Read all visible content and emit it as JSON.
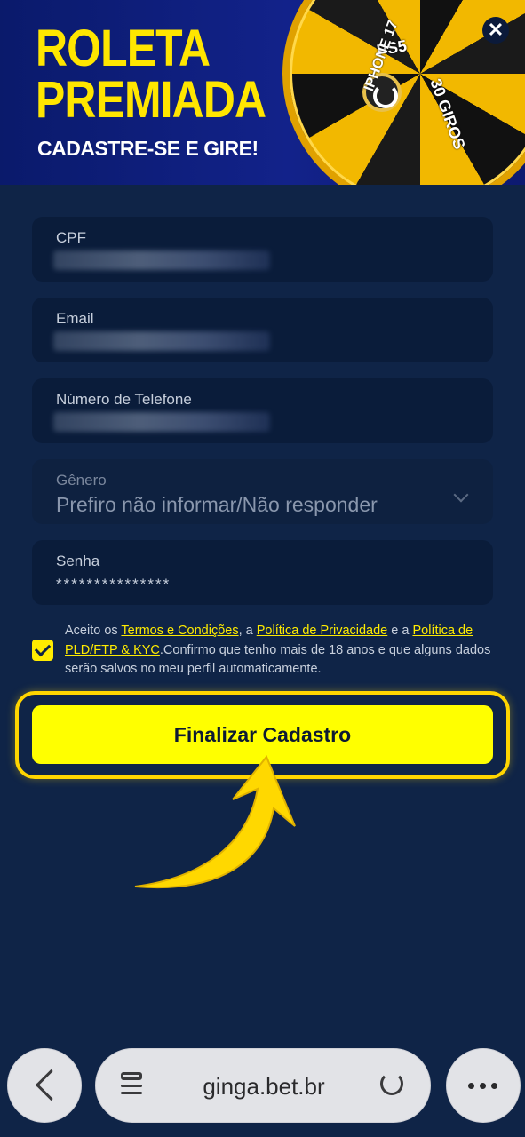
{
  "banner": {
    "title": "ROLETA PREMIADA",
    "subtitle": "CADASTRE-SE E GIRE!",
    "wheel_labels": [
      "PS5",
      "IPHONE 17",
      "30 GIROS"
    ],
    "close_label": "✕"
  },
  "form": {
    "cpf_label": "CPF",
    "email_label": "Email",
    "phone_label": "Número de Telefone",
    "gender_label": "Gênero",
    "gender_value": "Prefiro não informar/Não responder",
    "password_label": "Senha",
    "password_value": "***************"
  },
  "terms": {
    "prefix": "Aceito os ",
    "terms_link": "Termos e Condições",
    "sep1": ", a ",
    "privacy_link": "Política de Privacidade",
    "sep2": " e a ",
    "pld_link": "Política de PLD/FTP & KYC",
    "suffix": ".Confirmo que tenho mais de 18 anos e que alguns dados serão salvos no meu perfil automaticamente.",
    "checked": true
  },
  "cta": {
    "label": "Finalizar Cadastro"
  },
  "browser": {
    "url": "ginga.bet.br"
  },
  "colors": {
    "background": "#0f2447",
    "accent": "#ffff00",
    "field_bg": "#0a1c3a"
  }
}
